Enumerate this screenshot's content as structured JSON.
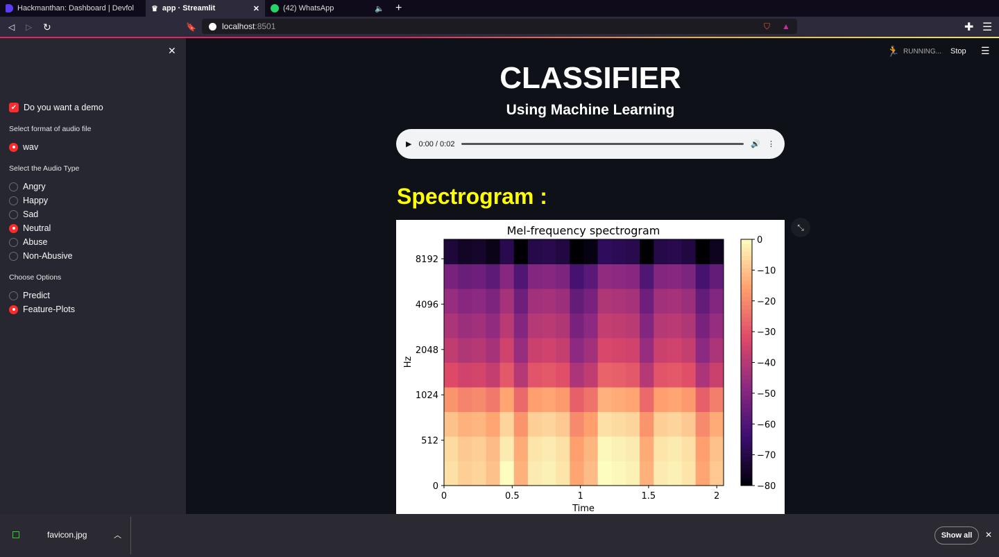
{
  "browser": {
    "tabs": [
      {
        "label": "Hackmanthan: Dashboard | Devfol",
        "icon": "devfolio-icon"
      },
      {
        "label": "app · Streamlit",
        "icon": "streamlit-crown-icon",
        "active": true
      },
      {
        "label": "(42) WhatsApp",
        "icon": "whatsapp-icon"
      }
    ],
    "url_host": "localhost",
    "url_port": ":8501"
  },
  "status": {
    "running": "RUNNING...",
    "stop": "Stop"
  },
  "sidebar": {
    "demo_checkbox": {
      "label": "Do you want a demo",
      "checked": true
    },
    "format": {
      "label": "Select format of audio file",
      "options": [
        "wav"
      ],
      "selected": "wav"
    },
    "audio_type": {
      "label": "Select the Audio Type",
      "options": [
        "Angry",
        "Happy",
        "Sad",
        "Neutral",
        "Abuse",
        "Non-Abusive"
      ],
      "selected": "Neutral"
    },
    "choose": {
      "label": "Choose Options",
      "options": [
        "Predict",
        "Feature-Plots"
      ],
      "selected": "Feature-Plots"
    }
  },
  "main": {
    "title": "CLASSIFIER",
    "subtitle": "Using Machine Learning",
    "audio_time": "0:00 / 0:02",
    "section_heading": "Spectrogram :",
    "accent": "#ffff00"
  },
  "chart_data": {
    "type": "heatmap",
    "title": "Mel-frequency spectrogram",
    "xlabel": "Time",
    "ylabel": "Hz",
    "xlim": [
      0,
      2.05
    ],
    "x_ticks": [
      "0",
      "0.5",
      "1",
      "1.5",
      "2"
    ],
    "x_tick_values": [
      0,
      0.5,
      1,
      1.5,
      2
    ],
    "ylim": [
      0,
      11025
    ],
    "y_scale": "mel",
    "y_ticks": [
      "0",
      "512",
      "1024",
      "2048",
      "4096",
      "8192"
    ],
    "y_tick_values": [
      0,
      512,
      1024,
      2048,
      4096,
      8192
    ],
    "colormap": "magma",
    "colorbar_range": [
      -80,
      0
    ],
    "colorbar_ticks": [
      "0",
      "−10",
      "−20",
      "−30",
      "−40",
      "−50",
      "−60",
      "−70",
      "−80"
    ],
    "colorbar_tick_values": [
      0,
      -10,
      -20,
      -30,
      -40,
      -50,
      -60,
      -70,
      -80
    ],
    "values_db_rows_low_to_high": [
      [
        -5,
        -8,
        -7,
        -10,
        0,
        -13,
        -3,
        -2,
        -4,
        -15,
        -11,
        0,
        -1,
        -2,
        -13,
        -3,
        -2,
        -4,
        -15,
        -9
      ],
      [
        -6,
        -9,
        -8,
        -11,
        -3,
        -14,
        -4,
        -3,
        -5,
        -16,
        -12,
        -1,
        -2,
        -3,
        -14,
        -4,
        -3,
        -5,
        -16,
        -10
      ],
      [
        -10,
        -13,
        -12,
        -15,
        -7,
        -18,
        -8,
        -7,
        -9,
        -20,
        -16,
        -5,
        -6,
        -7,
        -18,
        -8,
        -7,
        -9,
        -20,
        -14
      ],
      [
        -18,
        -21,
        -20,
        -23,
        -15,
        -26,
        -16,
        -15,
        -17,
        -28,
        -24,
        -13,
        -14,
        -15,
        -26,
        -16,
        -15,
        -17,
        -28,
        -22
      ],
      [
        -32,
        -35,
        -34,
        -37,
        -29,
        -40,
        -30,
        -29,
        -31,
        -42,
        -38,
        -27,
        -28,
        -29,
        -40,
        -30,
        -29,
        -31,
        -42,
        -36
      ],
      [
        -38,
        -41,
        -40,
        -43,
        -35,
        -46,
        -36,
        -35,
        -37,
        -48,
        -44,
        -33,
        -34,
        -35,
        -46,
        -36,
        -35,
        -37,
        -48,
        -42
      ],
      [
        -42,
        -45,
        -44,
        -47,
        -39,
        -50,
        -40,
        -39,
        -41,
        -52,
        -48,
        -37,
        -38,
        -39,
        -50,
        -40,
        -39,
        -41,
        -52,
        -46
      ],
      [
        -46,
        -49,
        -48,
        -51,
        -43,
        -54,
        -44,
        -43,
        -45,
        -56,
        -52,
        -41,
        -42,
        -43,
        -54,
        -44,
        -43,
        -45,
        -56,
        -50
      ],
      [
        -52,
        -55,
        -54,
        -57,
        -49,
        -60,
        -50,
        -49,
        -51,
        -62,
        -58,
        -47,
        -48,
        -49,
        -60,
        -50,
        -49,
        -51,
        -62,
        -56
      ],
      [
        -72,
        -75,
        -74,
        -77,
        -69,
        -80,
        -70,
        -69,
        -71,
        -80,
        -78,
        -67,
        -68,
        -69,
        -80,
        -70,
        -69,
        -71,
        -80,
        -76
      ]
    ]
  },
  "downloads": {
    "file": "favicon.jpg",
    "show_all": "Show all"
  }
}
